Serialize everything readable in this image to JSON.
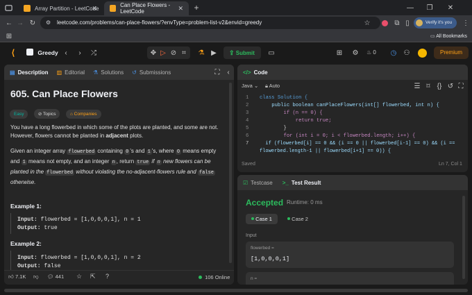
{
  "browser": {
    "tabs": [
      {
        "title": "Array Partition - LeetCode"
      },
      {
        "title": "Can Place Flowers - LeetCode"
      }
    ],
    "url": "leetcode.com/problems/can-place-flowers/?envType=problem-list-v2&envid=greedy",
    "verify_label": "Verify it's you",
    "all_bookmarks": "All Bookmarks"
  },
  "header": {
    "list_title": "Greedy",
    "submit_label": "Submit",
    "streak_count": "0",
    "premium_label": "Premium"
  },
  "left_panel": {
    "tabs": [
      "Description",
      "Editorial",
      "Solutions",
      "Submissions"
    ],
    "title": "605. Can Place Flowers",
    "tags": [
      "Easy",
      "Topics",
      "Companies"
    ],
    "para1_a": "You have a long flowerbed in which some of the plots are planted, and some are not. However, flowers cannot be planted in ",
    "para1_b": "adjacent",
    "para1_c": " plots.",
    "para2": {
      "t1": "Given an integer array ",
      "c1": "flowerbed",
      "t2": " containing ",
      "c2": "0",
      "t3": "'s and ",
      "c3": "1",
      "t4": "'s, where ",
      "c4": "0",
      "t5": " means empty",
      "t6": "and ",
      "c5": "1",
      "t7": " means not empty, and an integer ",
      "c6": "n",
      "t8": ", return ",
      "c7": "true",
      "t9": " if ",
      "c8": "n",
      "t10": " new flowers can be",
      "t11": "planted in the ",
      "c9": "flowerbed",
      "t12": " without violating the no-adjacent-flowers rule and ",
      "c10": "false",
      "t13": "otherwise."
    },
    "example1_title": "Example 1:",
    "example1_input_label": "Input:",
    "example1_input": " flowerbed = [1,0,0,0,1], n = 1",
    "example1_output_label": "Output:",
    "example1_output": " true",
    "example2_title": "Example 2:",
    "example2_input_label": "Input:",
    "example2_input": " flowerbed = [1,0,0,0,1], n = 2",
    "example2_output_label": "Output:",
    "example2_output": " false",
    "footer": {
      "likes": "7.1K",
      "comments": "441",
      "online": "106 Online"
    }
  },
  "code_panel": {
    "title": "Code",
    "language": "Java",
    "autocomplete": "Auto",
    "status": "Saved",
    "cursor": "Ln 7, Col 1",
    "lines": [
      {
        "n": "1",
        "text": "class Solution {"
      },
      {
        "n": "2",
        "text": "    public boolean canPlaceFlowers(int[] flowerbed, int n) {"
      },
      {
        "n": "3",
        "text": "        if (n == 0) {"
      },
      {
        "n": "4",
        "text": "            return true;"
      },
      {
        "n": "5",
        "text": "        }"
      },
      {
        "n": "6",
        "text": "        for (int i = 0; i < flowerbed.length; i++) {"
      },
      {
        "n": "7",
        "text": "  if (flowerbed[i] == 0 && (i == 0 || flowerbed[i-1] == 0) && (i =="
      },
      {
        "n": "",
        "text": "flowerbed.length-1 || flowerbed[i+1] == 0)) {"
      }
    ]
  },
  "test_panel": {
    "tabs": [
      "Testcase",
      "Test Result"
    ],
    "result": "Accepted",
    "runtime": "Runtime: 0 ms",
    "cases": [
      "Case 1",
      "Case 2"
    ],
    "input_label": "Input",
    "field1_label": "flowerbed =",
    "field1_value": "[1,0,0,0,1]",
    "field2_label": "n ="
  }
}
